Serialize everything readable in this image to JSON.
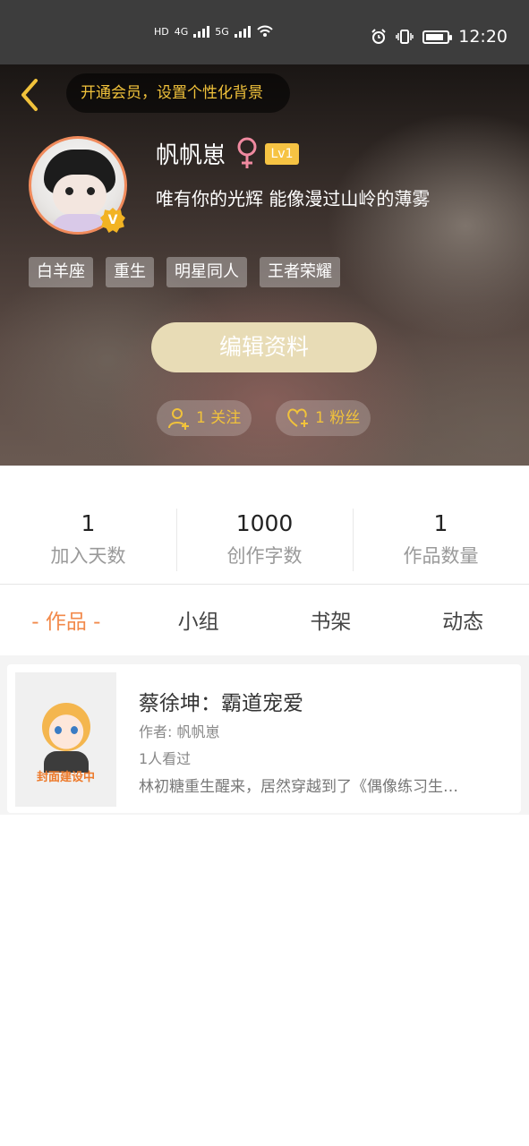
{
  "status_bar": {
    "network_labels": [
      "HD",
      "4G",
      "5G"
    ],
    "time": "12:20",
    "battery_percent": 85
  },
  "header": {
    "vip_banner": "开通会员，设置个性化背景"
  },
  "profile": {
    "name": "帆帆崽",
    "gender": "female",
    "level": "Lv1",
    "verified_badge": "V",
    "motto": "唯有你的光辉 能像漫过山岭的薄雾",
    "tags": [
      "白羊座",
      "重生",
      "明星同人",
      "王者荣耀"
    ],
    "edit_button": "编辑资料",
    "follow_label": "1 关注",
    "fans_label": "1 粉丝"
  },
  "stats": [
    {
      "value": "1",
      "label": "加入天数"
    },
    {
      "value": "1000",
      "label": "创作字数"
    },
    {
      "value": "1",
      "label": "作品数量"
    }
  ],
  "tabs": [
    {
      "label": "- 作品 -",
      "active": true
    },
    {
      "label": "小组",
      "active": false
    },
    {
      "label": "书架",
      "active": false
    },
    {
      "label": "动态",
      "active": false
    }
  ],
  "works": [
    {
      "cover_text": "封面建设中",
      "title": "蔡徐坤：霸道宠爱",
      "author": "作者: 帆帆崽",
      "views": "1人看过",
      "description": "林初糖重生醒来，居然穿越到了《偶像练习生…"
    }
  ],
  "colors": {
    "accent": "#f2894a",
    "gold": "#f1c23b",
    "edit_button_bg": "#e8dcb6"
  }
}
